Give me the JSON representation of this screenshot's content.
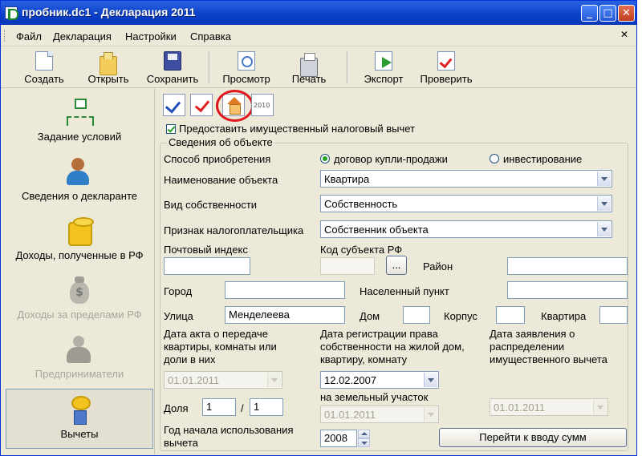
{
  "window": {
    "title": "пробник.dc1 - Декларация 2011"
  },
  "menu": [
    "Файл",
    "Декларация",
    "Настройки",
    "Справка"
  ],
  "toolbar": [
    {
      "label": "Создать",
      "icon": "new-document-icon"
    },
    {
      "label": "Открыть",
      "icon": "open-folder-icon"
    },
    {
      "label": "Сохранить",
      "icon": "save-disk-icon"
    },
    {
      "label": "Просмотр",
      "icon": "preview-icon"
    },
    {
      "label": "Печать",
      "icon": "printer-icon"
    },
    {
      "label": "Экспорт",
      "icon": "export-icon"
    },
    {
      "label": "Проверить",
      "icon": "check-icon"
    }
  ],
  "sidebar": [
    {
      "label": "Задание условий",
      "icon": "conditions-tree-icon",
      "enabled": true
    },
    {
      "label": "Сведения о декларанте",
      "icon": "declarant-person-icon",
      "enabled": true
    },
    {
      "label": "Доходы, полученные в РФ",
      "icon": "coins-icon",
      "enabled": true
    },
    {
      "label": "Доходы за пределами РФ",
      "icon": "money-bag-icon",
      "enabled": false
    },
    {
      "label": "Предприниматели",
      "icon": "entrepreneur-icon",
      "enabled": false
    },
    {
      "label": "Вычеты",
      "icon": "deductions-icon",
      "enabled": true,
      "active": true
    }
  ],
  "subtabs": [
    {
      "icon": "checklist-icon"
    },
    {
      "icon": "check-mark-icon"
    },
    {
      "icon": "house-icon",
      "highlighted": true,
      "highlight_color": "#e0141b"
    },
    {
      "icon": "year-2010-icon",
      "text": "2010"
    }
  ],
  "form": {
    "provide_deduction": {
      "label": "Предоставить имущественный налоговый вычет",
      "checked": true
    },
    "group_title": "Сведения об объекте",
    "acquisition": {
      "label": "Способ приобретения",
      "options": [
        "договор купли-продажи",
        "инвестирование"
      ],
      "selected": "договор купли-продажи"
    },
    "object_name": {
      "label": "Наименование объекта",
      "value": "Квартира"
    },
    "ownership_type": {
      "label": "Вид собственности",
      "value": "Собственность"
    },
    "taxpayer_attribute": {
      "label": "Признак налогоплательщика",
      "value": "Собственник объекта"
    },
    "postal_code": {
      "label": "Почтовый индекс",
      "value": ""
    },
    "region_code": {
      "label": "Код субъекта РФ",
      "value": "",
      "button": "..."
    },
    "district": {
      "label": "Район",
      "value": ""
    },
    "city": {
      "label": "Город",
      "value": ""
    },
    "settlement": {
      "label": "Населенный пункт",
      "value": ""
    },
    "street": {
      "label": "Улица",
      "value": "Менделеева"
    },
    "house": {
      "label": "Дом",
      "value": ""
    },
    "building": {
      "label": "Корпус",
      "value": ""
    },
    "apartment": {
      "label": "Квартира",
      "value": ""
    },
    "transfer_act_date": {
      "label": "Дата акта о передаче квартиры, комнаты или доли в них",
      "value": "01.01.2011",
      "enabled": false
    },
    "registration_date": {
      "label": "Дата регистрации права собственности на жилой дом, квартиру, комнату",
      "value": "12.02.2007",
      "enabled": true
    },
    "land_plot": {
      "label": "на земельный участок",
      "value": "01.01.2011",
      "enabled": false
    },
    "distribution_date": {
      "label": "Дата заявления о распределении имущественного вычета",
      "value": "01.01.2011",
      "enabled": false
    },
    "share": {
      "label": "Доля",
      "numerator": "1",
      "separator": "/",
      "denominator": "1"
    },
    "start_year": {
      "label": "Год начала использования вычета",
      "value": "2008"
    },
    "go_button": "Перейти к вводу сумм"
  },
  "colors": {
    "titlebar": "#0a3fc8",
    "face": "#ece9d8",
    "radio_dot": "#21a121",
    "highlight": "#e0141b"
  }
}
